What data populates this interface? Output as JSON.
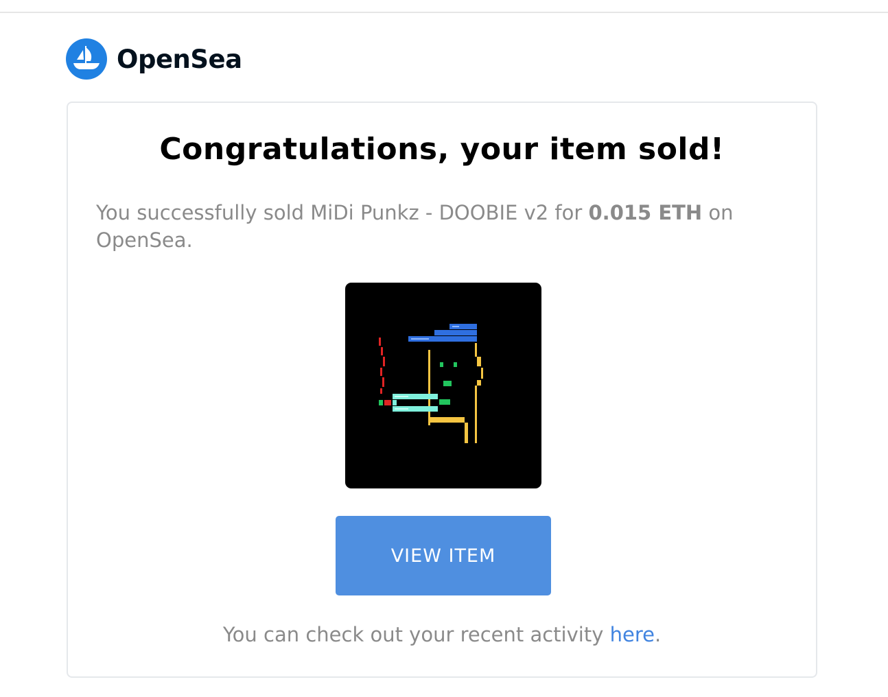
{
  "brand": {
    "name": "OpenSea",
    "logo_icon": "opensea-boat-icon",
    "logo_color": "#2081e2"
  },
  "email": {
    "headline": "Congratulations, your item sold!",
    "sale": {
      "prefix": "You successfully sold MiDi Punkz - DOOBIE v2 for",
      "price": "0.015 ETH",
      "suffix": "on OpenSea."
    },
    "item_image_icon": "nft-pixel-art-image",
    "view_button_label": "VIEW ITEM",
    "view_button_color": "#4f8fe0",
    "activity": {
      "prefix": "You can check out your recent activity",
      "link_label": "here",
      "suffix": "."
    },
    "link_color": "#4184e0"
  }
}
